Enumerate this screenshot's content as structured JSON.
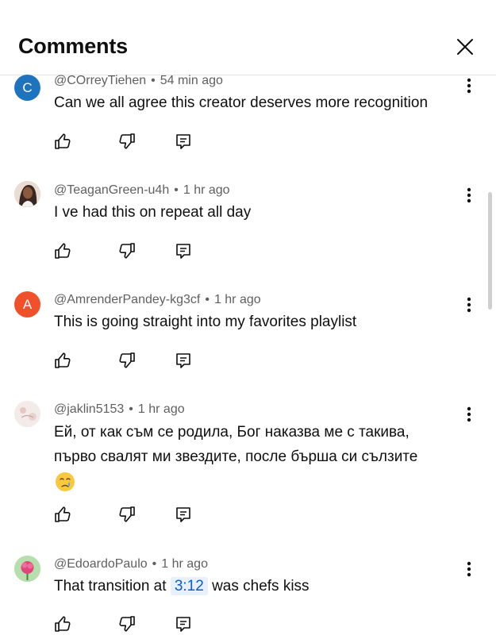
{
  "header": {
    "title": "Comments"
  },
  "comments": [
    {
      "handle": "@COrreyTiehen",
      "time": "54 min ago",
      "text": "Can we all agree this creator deserves more recognition",
      "avatar_letter": "C",
      "avatar_color": "#1e73be"
    },
    {
      "handle": "@TeaganGreen-u4h",
      "time": "1 hr ago",
      "text": "I ve had this on repeat all day",
      "avatar_letter": "",
      "avatar_color": "#5a4036"
    },
    {
      "handle": "@AmrenderPandey-kg3cf",
      "time": "1 hr ago",
      "text": "This is going straight into my favorites playlist",
      "avatar_letter": "A",
      "avatar_color": "#f0502a"
    },
    {
      "handle": "@jaklin5153",
      "time": "1 hr ago",
      "text_line1": "Ей, от как съм се родила, Бог наказва ме с такива,",
      "text_line2": "първо свалят ми звездите, после бърша си сълзите",
      "emoji": "crying-face",
      "avatar_letter": "",
      "avatar_color": "#efe4e0"
    },
    {
      "handle": "@EdoardoPaulo",
      "time": "1 hr ago",
      "text_before": "That transition at",
      "timestamp_link": "3:12",
      "text_after": "was chefs kiss",
      "avatar_letter": "",
      "avatar_color": "#9fd39b"
    }
  ],
  "colors": {
    "link": "#065fd4",
    "link_bg": "#e8f0fd",
    "meta": "#606060"
  }
}
